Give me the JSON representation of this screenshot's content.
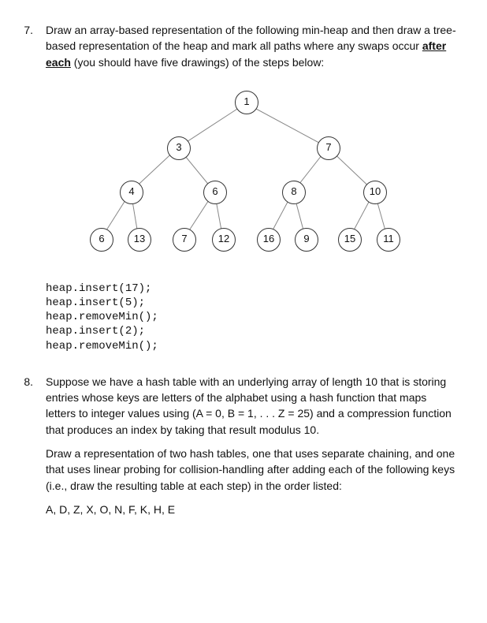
{
  "q7": {
    "number": "7.",
    "text_p1a": "Draw an array-based representation of the following min-heap and then draw a tree-based representation of the heap and mark all paths where any swaps occur ",
    "text_p1_bold": "after each",
    "text_p1b": " (you should have five drawings) of the steps below:",
    "code": "heap.insert(17);\nheap.insert(5);\nheap.removeMin();\nheap.insert(2);\nheap.removeMin();"
  },
  "tree": {
    "nodes": {
      "n1": "1",
      "n3": "3",
      "n7": "7",
      "n4": "4",
      "n6a": "6",
      "n8": "8",
      "n10": "10",
      "n6b": "6",
      "n13": "13",
      "n7b": "7",
      "n12": "12",
      "n16": "16",
      "n9": "9",
      "n15": "15",
      "n11": "11"
    }
  },
  "q8": {
    "number": "8.",
    "text_p1": "Suppose we have a hash table with an underlying array of length 10 that is storing entries whose keys are letters of the alphabet using a hash function that maps letters to integer values using (A = 0, B = 1, . . . Z = 25) and a compression function that produces an index by taking that result modulus 10.",
    "text_p2": "Draw a representation of two hash tables, one that uses separate chaining, and one that uses linear probing for collision-handling after adding each of the following keys (i.e., draw the resulting table at each step) in the order listed:",
    "keys": "A, D, Z, X, O, N, F, K, H, E"
  }
}
